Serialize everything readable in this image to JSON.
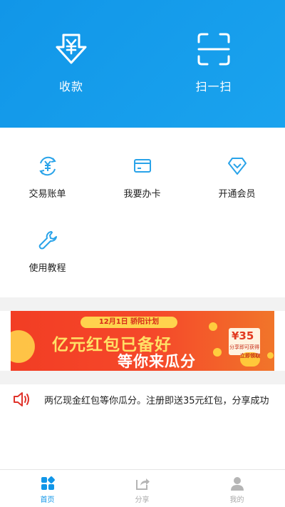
{
  "header": {
    "collect_label": "收款",
    "scan_label": "扫一扫",
    "collect_icon": "download-yen-icon",
    "scan_icon": "scan-frame-icon"
  },
  "grid": {
    "items": [
      {
        "label": "交易账单",
        "icon": "yen-cycle-icon"
      },
      {
        "label": "我要办卡",
        "icon": "card-icon"
      },
      {
        "label": "开通会员",
        "icon": "diamond-icon"
      },
      {
        "label": "使用教程",
        "icon": "wrench-icon"
      }
    ]
  },
  "banner": {
    "tag": "12月1日 骄阳计划",
    "title": "亿元红包已备好",
    "subtitle": "等你来瓜分",
    "amount": "¥35",
    "envelope_text": "分享即可获得",
    "claim_label": "立即领取"
  },
  "notice": {
    "text": "两亿现金红包等你瓜分。注册即送35元红包，分享成功"
  },
  "tabbar": {
    "items": [
      {
        "label": "首页",
        "icon": "home-grid-icon",
        "active": true
      },
      {
        "label": "分享",
        "icon": "share-icon",
        "active": false
      },
      {
        "label": "我的",
        "icon": "profile-icon",
        "active": false
      }
    ]
  },
  "colors": {
    "primary": "#1196e8",
    "banner_red": "#f23d24",
    "accent_yellow": "#ffd34d",
    "notice_icon": "#e0322a"
  }
}
